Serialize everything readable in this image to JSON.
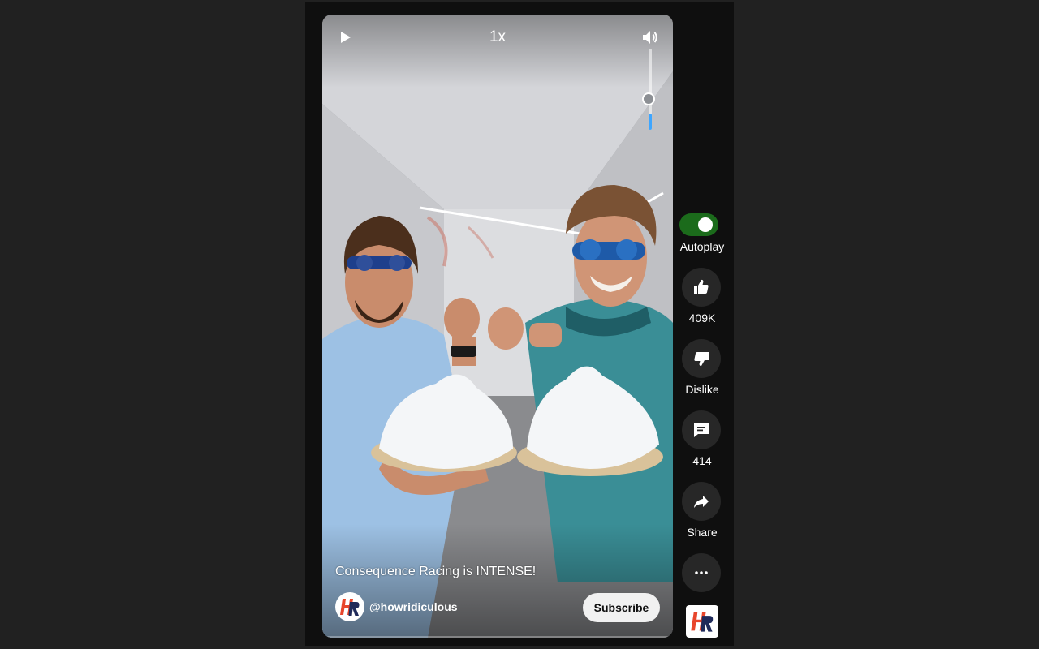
{
  "player": {
    "speed": "1x",
    "volume_level": 0.2,
    "title": "Consequence Racing is INTENSE!",
    "channel_handle": "@howridiculous",
    "subscribe_label": "Subscribe",
    "icons": [
      "play-icon",
      "volume-icon",
      "channel-logo"
    ]
  },
  "sidebar": {
    "autoplay_label": "Autoplay",
    "autoplay_on": true,
    "like_count": "409K",
    "dislike_label": "Dislike",
    "comment_count": "414",
    "share_label": "Share",
    "icons": [
      "thumbs-up-icon",
      "thumbs-down-icon",
      "comment-icon",
      "share-icon",
      "more-icon"
    ]
  },
  "colors": {
    "page_bg": "#212121",
    "panel_bg": "#0f0f0f",
    "autoplay_on": "#1b6b1b",
    "volume_fill": "#3ea6ff",
    "button_bg": "#272727",
    "logo_red": "#e8452b",
    "logo_navy": "#1f2a5a"
  }
}
